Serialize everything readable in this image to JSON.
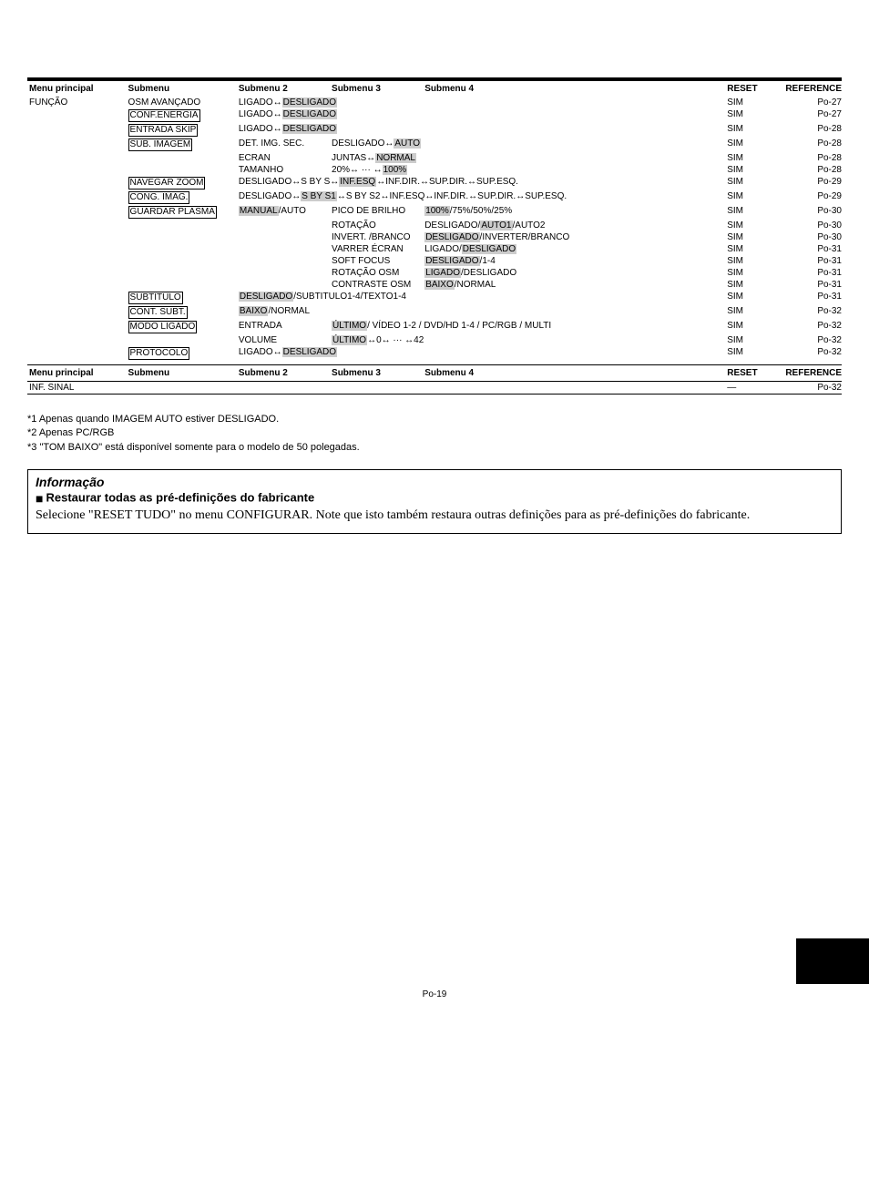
{
  "headers": {
    "main": "Menu principal",
    "sub": "Submenu",
    "sub2": "Submenu 2",
    "sub3": "Submenu 3",
    "sub4": "Submenu 4",
    "reset": "RESET",
    "ref": "REFERENCE"
  },
  "main_label": "FUNÇÃO",
  "rows": [
    {
      "sub": "OSM AVANÇADO",
      "sub_box": false,
      "sub2": "LIGADO↔",
      "sub2_hl": "DESLIGADO",
      "reset": "SIM",
      "ref": "Po-27"
    },
    {
      "sub": "CONF.ENERGIA",
      "sub_box": true,
      "sub2": "LIGADO↔",
      "sub2_hl": "DESLIGADO",
      "reset": "SIM",
      "ref": "Po-27"
    },
    {
      "sub": "ENTRADA SKIP",
      "sub_box": true,
      "sub2": "LIGADO↔",
      "sub2_hl": "DESLIGADO",
      "reset": "SIM",
      "ref": "Po-28"
    },
    {
      "sub": "SUB. IMAGEM",
      "sub_box": true,
      "sub2": "DET. IMG. SEC.",
      "sub3": "DESLIGADO↔",
      "sub3_hl": "AUTO",
      "reset": "SIM",
      "ref": "Po-28"
    },
    {
      "sub": "",
      "sub2": "ECRAN",
      "sub3": "JUNTAS↔",
      "sub3_hl": "NORMAL",
      "reset": "SIM",
      "ref": "Po-28"
    },
    {
      "sub": "",
      "sub2": "TAMANHO",
      "sub3": "20%↔ ··· ↔",
      "sub3_hl": "100%",
      "reset": "SIM",
      "ref": "Po-28"
    },
    {
      "sub": "NAVEGAR ZOOM",
      "sub_box": true,
      "sub2": "DESLIGADO↔S BY S↔",
      "sub2_hl": "INF.ESQ",
      "sub2_tail": "↔INF.DIR.↔SUP.DIR.↔SUP.ESQ.",
      "span": true,
      "reset": "SIM",
      "ref": "Po-29"
    },
    {
      "sub": "CONG. IMAG.",
      "sub_box": true,
      "sub2": "DESLIGADO↔",
      "sub2_hl": "S BY S1",
      "sub2_tail": "↔S BY S2↔INF.ESQ↔INF.DIR.↔SUP.DIR.↔SUP.ESQ.",
      "span": true,
      "reset": "SIM",
      "ref": "Po-29"
    },
    {
      "sub": "GUARDAR PLASMA",
      "sub_box": true,
      "sub2_hl_first": "MANUAL",
      "sub2_tail_first": "/AUTO",
      "sub3": "PICO DE BRILHO",
      "sub4_hl": "100%",
      "sub4_tail": "/75%/50%/25%",
      "reset": "SIM",
      "ref": "Po-30"
    },
    {
      "sub": "",
      "sub2": "",
      "sub3": "ROTAÇÃO",
      "sub4": "DESLIGADO/",
      "sub4_hl": "AUTO1",
      "sub4_tail": "/AUTO2",
      "reset": "SIM",
      "ref": "Po-30"
    },
    {
      "sub": "",
      "sub2": "",
      "sub3": "INVERT. /BRANCO",
      "sub4_hl": "DESLIGADO",
      "sub4_tail": "/INVERTER/BRANCO",
      "reset": "SIM",
      "ref": "Po-30"
    },
    {
      "sub": "",
      "sub2": "",
      "sub3": "VARRER ÉCRAN",
      "sub4": "LIGADO/",
      "sub4_hl": "DESLIGADO",
      "reset": "SIM",
      "ref": "Po-31"
    },
    {
      "sub": "",
      "sub2": "",
      "sub3": "SOFT FOCUS",
      "sub4_hl": "DESLIGADO",
      "sub4_tail": "/1-4",
      "reset": "SIM",
      "ref": "Po-31"
    },
    {
      "sub": "",
      "sub2": "",
      "sub3": "ROTAÇÃO OSM",
      "sub4_hl": "LIGADO",
      "sub4_tail": "/DESLIGADO",
      "reset": "SIM",
      "ref": "Po-31"
    },
    {
      "sub": "",
      "sub2": "",
      "sub3": "CONTRASTE OSM",
      "sub4_hl": "BAIXO",
      "sub4_tail": "/NORMAL",
      "reset": "SIM",
      "ref": "Po-31"
    },
    {
      "sub": "SUBTITULO",
      "sub_box": true,
      "sub2_hl_first": "DESLIGADO",
      "sub2_tail_first": "/SUBTITULO1-4/TEXTO1-4",
      "span": true,
      "reset": "SIM",
      "ref": "Po-31"
    },
    {
      "sub": "CONT. SUBT.",
      "sub_box": true,
      "sub2_hl_first": "BAIXO",
      "sub2_tail_first": "/NORMAL",
      "span": true,
      "reset": "SIM",
      "ref": "Po-32"
    },
    {
      "sub": "MODO LIGADO",
      "sub_box": true,
      "sub2": "ENTRADA",
      "sub3_hl": "ÚLTIMO",
      "sub3_tail": "/ VÍDEO 1-2 / DVD/HD 1-4 / PC/RGB / MULTI",
      "span3": true,
      "reset": "SIM",
      "ref": "Po-32"
    },
    {
      "sub": "",
      "sub2": "VOLUME",
      "sub3_hl": "ÚLTIMO",
      "sub3_tail": "↔0↔ ··· ↔42",
      "span3": true,
      "reset": "SIM",
      "ref": "Po-32"
    },
    {
      "sub": "PROTOCOLO",
      "sub_box": true,
      "sub2": "LIGADO↔",
      "sub2_hl": "DESLIGADO",
      "reset": "SIM",
      "ref": "Po-32"
    }
  ],
  "secondary_row": {
    "main": "INF. SINAL",
    "reset": "—",
    "ref": "Po-32"
  },
  "notes": [
    "*1 Apenas quando IMAGEM AUTO estiver DESLIGADO.",
    "*2 Apenas PC/RGB",
    "*3 \"TOM BAIXO\" está disponível somente para o modelo de 50 polegadas."
  ],
  "info": {
    "title": "Informação",
    "heading": "Restaurar todas as pré-definições do fabricante",
    "body": "Selecione \"RESET TUDO\" no menu CONFIGURAR. Note que isto também restaura outras definições para as pré-definições do fabricante."
  },
  "page": "Po-19"
}
